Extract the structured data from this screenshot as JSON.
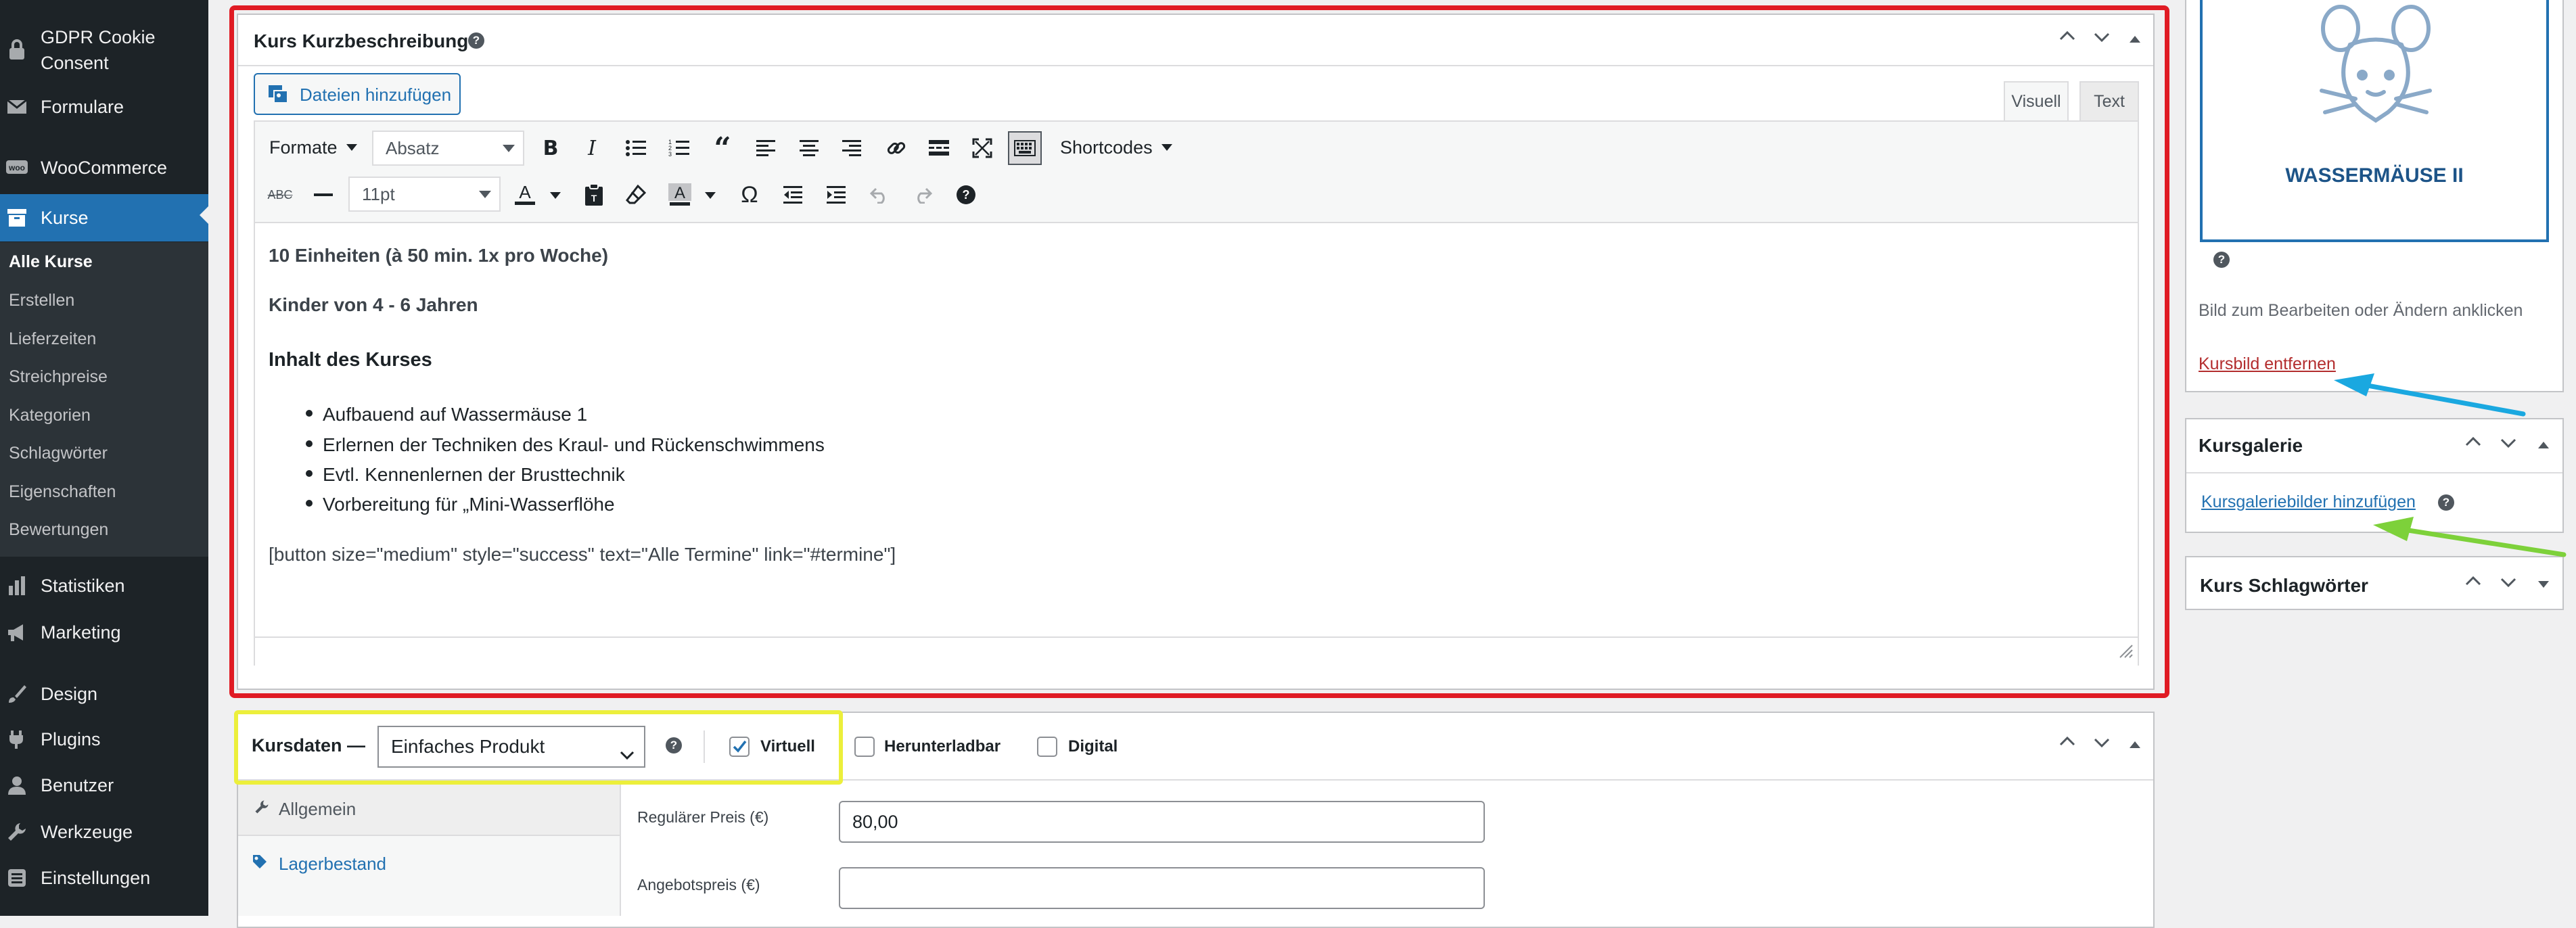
{
  "sidebar": {
    "top_items": [
      {
        "label": "GDPR Cookie Consent",
        "icon": "lock-icon"
      },
      {
        "label": "Formulare",
        "icon": "mail-icon"
      },
      {
        "label": "WooCommerce",
        "icon": "woocommerce-icon"
      },
      {
        "label": "Kurse",
        "icon": "archive-icon"
      }
    ],
    "submenu": [
      "Alle Kurse",
      "Erstellen",
      "Lieferzeiten",
      "Streichpreise",
      "Kategorien",
      "Schlagwörter",
      "Eigenschaften",
      "Bewertungen"
    ],
    "bottom_items": [
      {
        "label": "Statistiken",
        "icon": "bar-chart-icon"
      },
      {
        "label": "Marketing",
        "icon": "megaphone-icon"
      },
      {
        "label": "Design",
        "icon": "paintbrush-icon"
      },
      {
        "label": "Plugins",
        "icon": "plug-icon"
      },
      {
        "label": "Benutzer",
        "icon": "user-icon"
      },
      {
        "label": "Werkzeuge",
        "icon": "wrench-icon"
      },
      {
        "label": "Einstellungen",
        "icon": "settings-icon"
      }
    ]
  },
  "short_desc": {
    "title": "Kurs Kurzbeschreibung",
    "add_media": "Dateien hinzufügen",
    "tab_visual": "Visuell",
    "tab_text": "Text",
    "format_menu": "Formate",
    "paragraph_select": "Absatz",
    "shortcodes": "Shortcodes",
    "font_size": "11pt",
    "content": {
      "line1": "10 Einheiten (à 50 min. 1x pro Woche)",
      "line2": "Kinder von 4 - 6 Jahren",
      "heading": "Inhalt des Kurses",
      "bullets": [
        "Aufbauend auf Wassermäuse 1",
        "Erlernen der Techniken des Kraul- und Rückenschwimmens",
        "Evtl. Kennenlernen der Brusttechnik",
        "Vorbereitung für „Mini-Wasserflöhe"
      ],
      "shortcode": "[button size=\"medium\" style=\"success\" text=\"Alle Termine\" link=\"#termine\"]"
    }
  },
  "product_data": {
    "label": "Kursdaten —",
    "type_select": "Einfaches Produkt",
    "virtual": "Virtuell",
    "downloadable": "Herunterladbar",
    "digital": "Digital",
    "tabs": [
      "Allgemein",
      "Lagerbestand"
    ],
    "regular_price_label": "Regulärer Preis (€)",
    "regular_price": "80,00",
    "sale_price_label": "Angebotspreis (€)",
    "sale_price": ""
  },
  "right_panel": {
    "image_caption": "WASSERMÄUSE II",
    "image_hint": "Bild zum Bearbeiten oder Ändern anklicken",
    "remove_image": "Kursbild entfernen",
    "gallery_title": "Kursgalerie",
    "gallery_link": "Kursgaleriebilder hinzufügen",
    "tags_title": "Kurs Schlagwörter"
  },
  "colors": {
    "highlight_red": "#e01b24",
    "highlight_yellow": "#ecef3b",
    "arrow_blue": "#1aa8e0",
    "arrow_green": "#7dd13a",
    "admin_blue": "#2271b1",
    "sidebar_bg": "#1d2327"
  }
}
